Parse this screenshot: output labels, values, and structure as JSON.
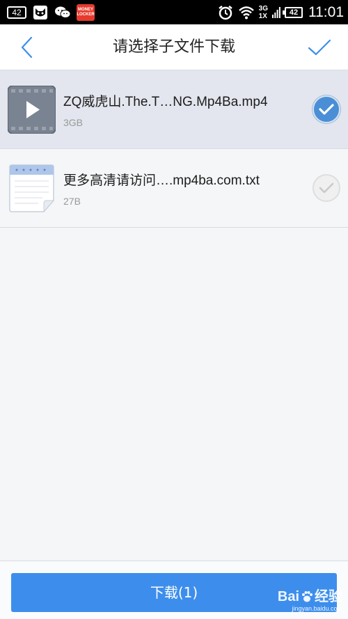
{
  "status_bar": {
    "notification_count": "42",
    "money_app_label": "MONEY LOCKER",
    "network_top": "3G",
    "network_bottom": "1X",
    "battery": "42",
    "time": "11:01"
  },
  "header": {
    "title": "请选择子文件下载"
  },
  "files": [
    {
      "name": "ZQ威虎山.The.T…NG.Mp4Ba.mp4",
      "size": "3GB",
      "type": "video",
      "selected": true
    },
    {
      "name": "更多高清请访问….mp4ba.com.txt",
      "size": "27B",
      "type": "text",
      "selected": false
    }
  ],
  "footer": {
    "download_label": "下载(1)"
  },
  "watermark": {
    "brand": "Bai",
    "brand_suffix": "经验",
    "url": "jingyan.baidu.com"
  },
  "colors": {
    "accent": "#3d8eec",
    "check_on": "#4a8fd6",
    "selected_row": "#e3e6ee"
  }
}
